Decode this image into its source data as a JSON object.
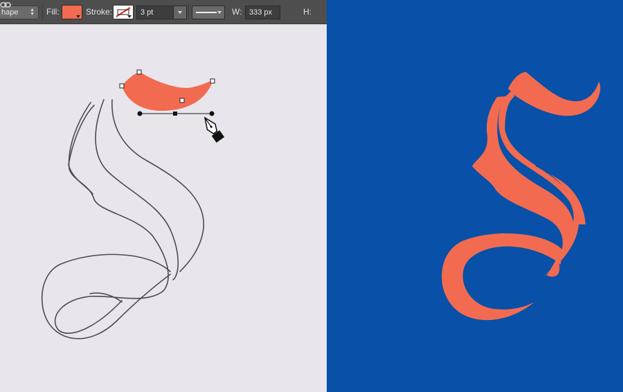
{
  "options_bar": {
    "mode_label": "hape",
    "fill_label": "Fill:",
    "stroke_label": "Stroke:",
    "stroke_width": "3 pt",
    "width_label": "W:",
    "width_value": "333 px",
    "height_label": "H:",
    "icons": [
      "mode-dropdown-arrows-icon",
      "fill-swatch-icon",
      "stroke-swatch-icon",
      "stroke-width-dropdown-icon",
      "line-style-dropdown-icon",
      "link-proportions-icon"
    ]
  },
  "colors": {
    "fill": "#f26b50",
    "logo_background": "#0850a8",
    "toolbar_background": "#4e4e4e",
    "paper": "#e8e6ec"
  },
  "canvas": {
    "tool_icon": "pen-tool-cursor-icon"
  }
}
